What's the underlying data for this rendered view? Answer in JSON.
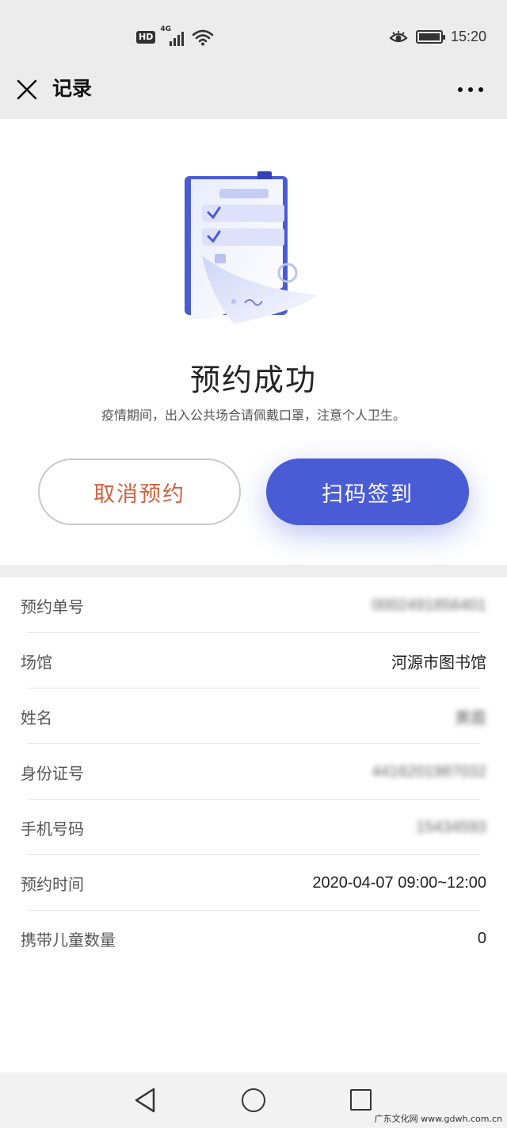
{
  "status_bar": {
    "hd_label": "HD",
    "network_label": "4G",
    "time": "15:20",
    "battery_level": 1.0,
    "icons": [
      "hd-icon",
      "signal-icon",
      "wifi-icon",
      "eye-comfort-icon",
      "battery-icon"
    ]
  },
  "nav": {
    "title": "记录",
    "close_icon": "close-icon",
    "more_icon": "more-icon"
  },
  "hero": {
    "illustration": "document-check-illustration",
    "title": "预约成功",
    "subtitle": "疫情期间，出入公共场合请佩戴口罩，注意个人卫生。",
    "cancel_label": "取消预约",
    "scan_label": "扫码签到"
  },
  "details": [
    {
      "label": "预约单号",
      "value": "0002491856401",
      "blurred": true
    },
    {
      "label": "场馆",
      "value": "河源市图书馆",
      "blurred": false
    },
    {
      "label": "姓名",
      "value": "黄霞",
      "blurred": true
    },
    {
      "label": "身份证号",
      "value": "4416201987032",
      "blurred": true
    },
    {
      "label": "手机号码",
      "value": "15434593",
      "blurred": true
    },
    {
      "label": "预约时间",
      "value": "2020-04-07 09:00~12:00",
      "blurred": false
    },
    {
      "label": "携带儿童数量",
      "value": "0",
      "blurred": false
    }
  ],
  "bottom_nav": {
    "icons": [
      "back-icon",
      "home-icon",
      "recent-apps-icon"
    ],
    "watermark": "广东文化网 www.gdwh.com.cn"
  },
  "colors": {
    "accent": "#4a5bd6",
    "cancel_text": "#d0623e",
    "bar_bg": "#ececec"
  }
}
